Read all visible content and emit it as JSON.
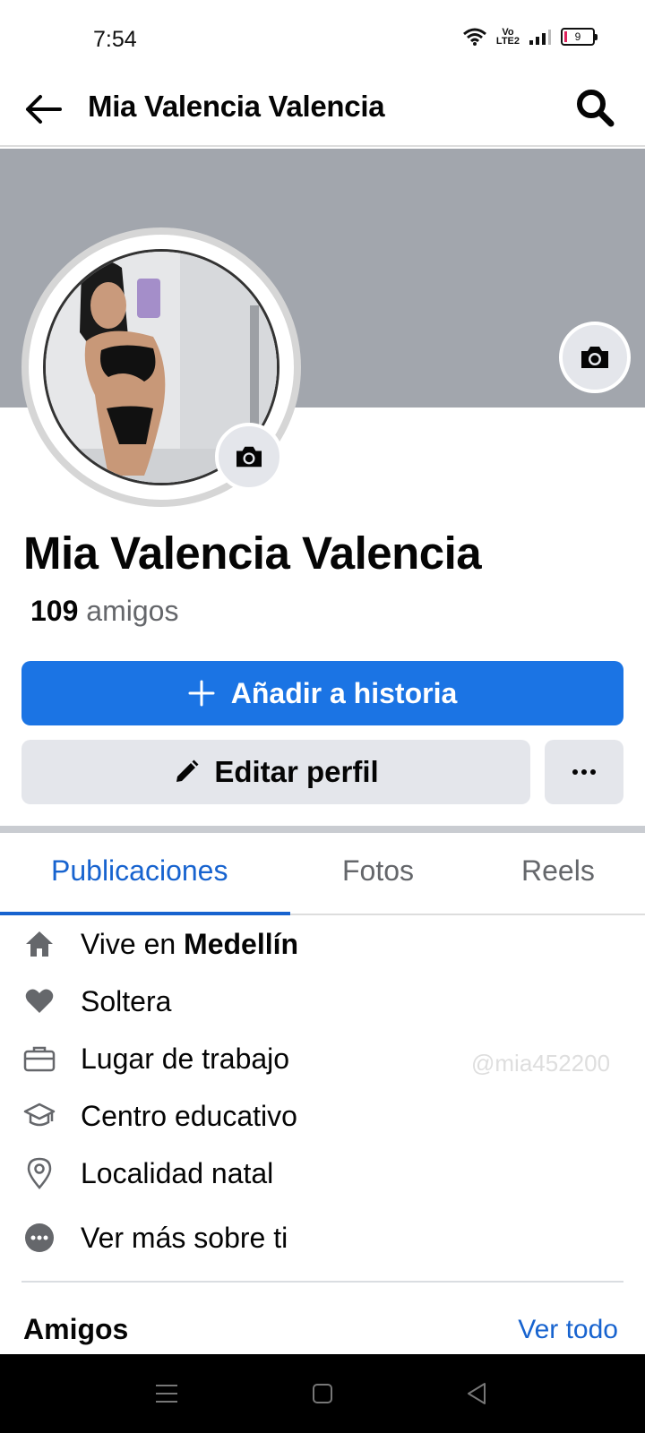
{
  "status_bar": {
    "time": "7:54",
    "volte_top": "Vo",
    "volte_bottom": "LTE2",
    "battery": "9",
    "battery_color": "#e0245e"
  },
  "header": {
    "title": "Mia Valencia Valencia",
    "back_icon": "arrow-left-icon",
    "search_icon": "search-icon"
  },
  "profile": {
    "name": "Mia Valencia Valencia",
    "friends_number": "109",
    "friends_label": " amigos",
    "cover_color": "#a2a6ad"
  },
  "actions": {
    "add_story_label": "Añadir a historia",
    "edit_profile_label": "Editar perfil",
    "primary_color": "#1b74e4"
  },
  "tabs": [
    {
      "label": "Publicaciones",
      "active": true
    },
    {
      "label": "Fotos",
      "active": false
    },
    {
      "label": "Reels",
      "active": false
    }
  ],
  "details": {
    "lives_prefix": "Vive en ",
    "lives_city": "Medellín",
    "relationship": "Soltera",
    "workplace": "Lugar de trabajo",
    "education": "Centro educativo",
    "hometown": "Localidad natal",
    "see_more": "Ver más sobre ti"
  },
  "watermark": "@mia452200",
  "friends_section": {
    "title": "Amigos",
    "see_all": "Ver todo",
    "link_color": "#1763cf"
  }
}
